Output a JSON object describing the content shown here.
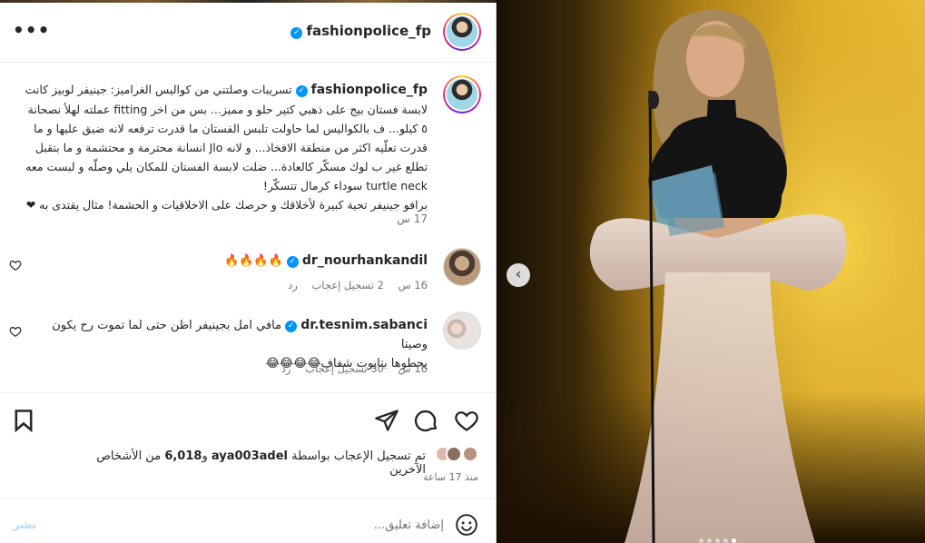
{
  "header": {
    "username": "fashionpolice_fp",
    "more_label": "•••"
  },
  "caption": {
    "username": "fashionpolice_fp",
    "lines": [
      "تسريبات وصلتني من كواليس الغراميز: جينيفر لوبيز كانت",
      "لابسة فستان بيج على ذهبي كتير حلو و مميز... بس من اخر fitting عملته لهلأ نصحانة",
      "٥ كيلو... ف بالكواليس لما حاولت تلبس الفستان ما قدرت ترفعه لانه ضيق عليها و ما",
      "قدرت تعلّيه اكثر من منطقة الافخاذ... و لانه Jlo انسانة محترمة و محتشمة و ما بتقبل",
      "تطلع غير ب لوك مسكّر كالعادة... ضلت لابسة الفستان للمكان يلي وصلّه و لبست معه",
      "turtle neck سوداء كرمال تتسكّر!",
      "برافو جينيفر تحية كبيرة لأخلاقك و حرصك على الاخلاقيات و الحشمة! مثال يقتدى به ❤"
    ],
    "time": "17 س"
  },
  "comments": [
    {
      "username": "dr_nourhankandil",
      "text": "🔥🔥🔥🔥",
      "time": "16 س",
      "likes": "2 تسجيل إعجاب",
      "reply": "رد"
    },
    {
      "username": "dr.tesnim.sabanci",
      "text": "مافي امل بجينيفر اظن حتى لما تموت رح يكون وصيتا",
      "text2": "يحطوها بتابوت شفاف😂😂😂😂",
      "time": "16 س",
      "likes": "30 تسجيل إعجاب",
      "reply": "رد"
    }
  ],
  "likes": {
    "prefix": "تم تسجيل الإعجاب بواسطة",
    "user": "aya003adel",
    "middle": "و",
    "count": "6,018",
    "suffix": "من الأشخاص الآخرين"
  },
  "posted": "منذ 17 ساعة",
  "add_comment": {
    "placeholder": "إضافة تعليق...",
    "post_label": "نشر"
  },
  "photo": {
    "dots_count": 5,
    "active_dot": 4
  },
  "icons": {
    "more": "more-horizontal-icon",
    "verified": "verified-badge-icon",
    "heart": "heart-icon",
    "comment": "comment-icon",
    "share": "share-icon",
    "bookmark": "bookmark-icon",
    "emoji": "emoji-icon",
    "prev": "chevron-left-icon"
  },
  "colors": {
    "verified": "#0095f6",
    "muted": "#737373",
    "post_disabled": "#b2dffc"
  }
}
